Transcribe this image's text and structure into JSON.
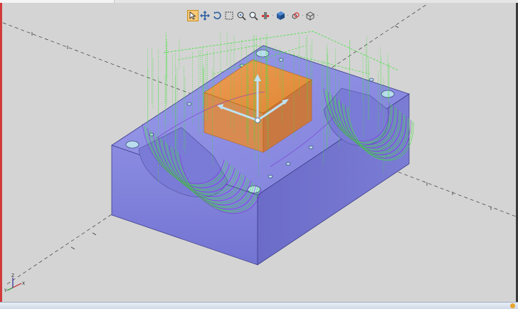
{
  "toolbar": {
    "tools": [
      {
        "name": "select-arrow-icon",
        "active": true
      },
      {
        "name": "pan-icon",
        "active": false
      },
      {
        "name": "rotate-icon",
        "active": false
      },
      {
        "name": "zoom-window-icon",
        "active": false
      },
      {
        "name": "zoom-icon",
        "active": false
      },
      {
        "name": "zoom-fit-icon",
        "active": false
      },
      {
        "name": "section-plane-icon",
        "active": false
      },
      {
        "name": "shaded-view-icon",
        "active": false
      },
      {
        "name": "visibility-icon",
        "active": false
      },
      {
        "name": "view-orientation-icon",
        "active": false
      }
    ]
  },
  "triad": {
    "x": "X",
    "y": "Y",
    "z": "Z"
  },
  "colors": {
    "background": "#d4d4d4",
    "part_body": "#8d8ee2",
    "stock": "#f28a2a",
    "toolpath_primary": "#3fe23a",
    "toolpath_secondary": "#7d2fd9",
    "triad_handle": "#bfe2f5",
    "status_indicator": "#e8a431"
  }
}
